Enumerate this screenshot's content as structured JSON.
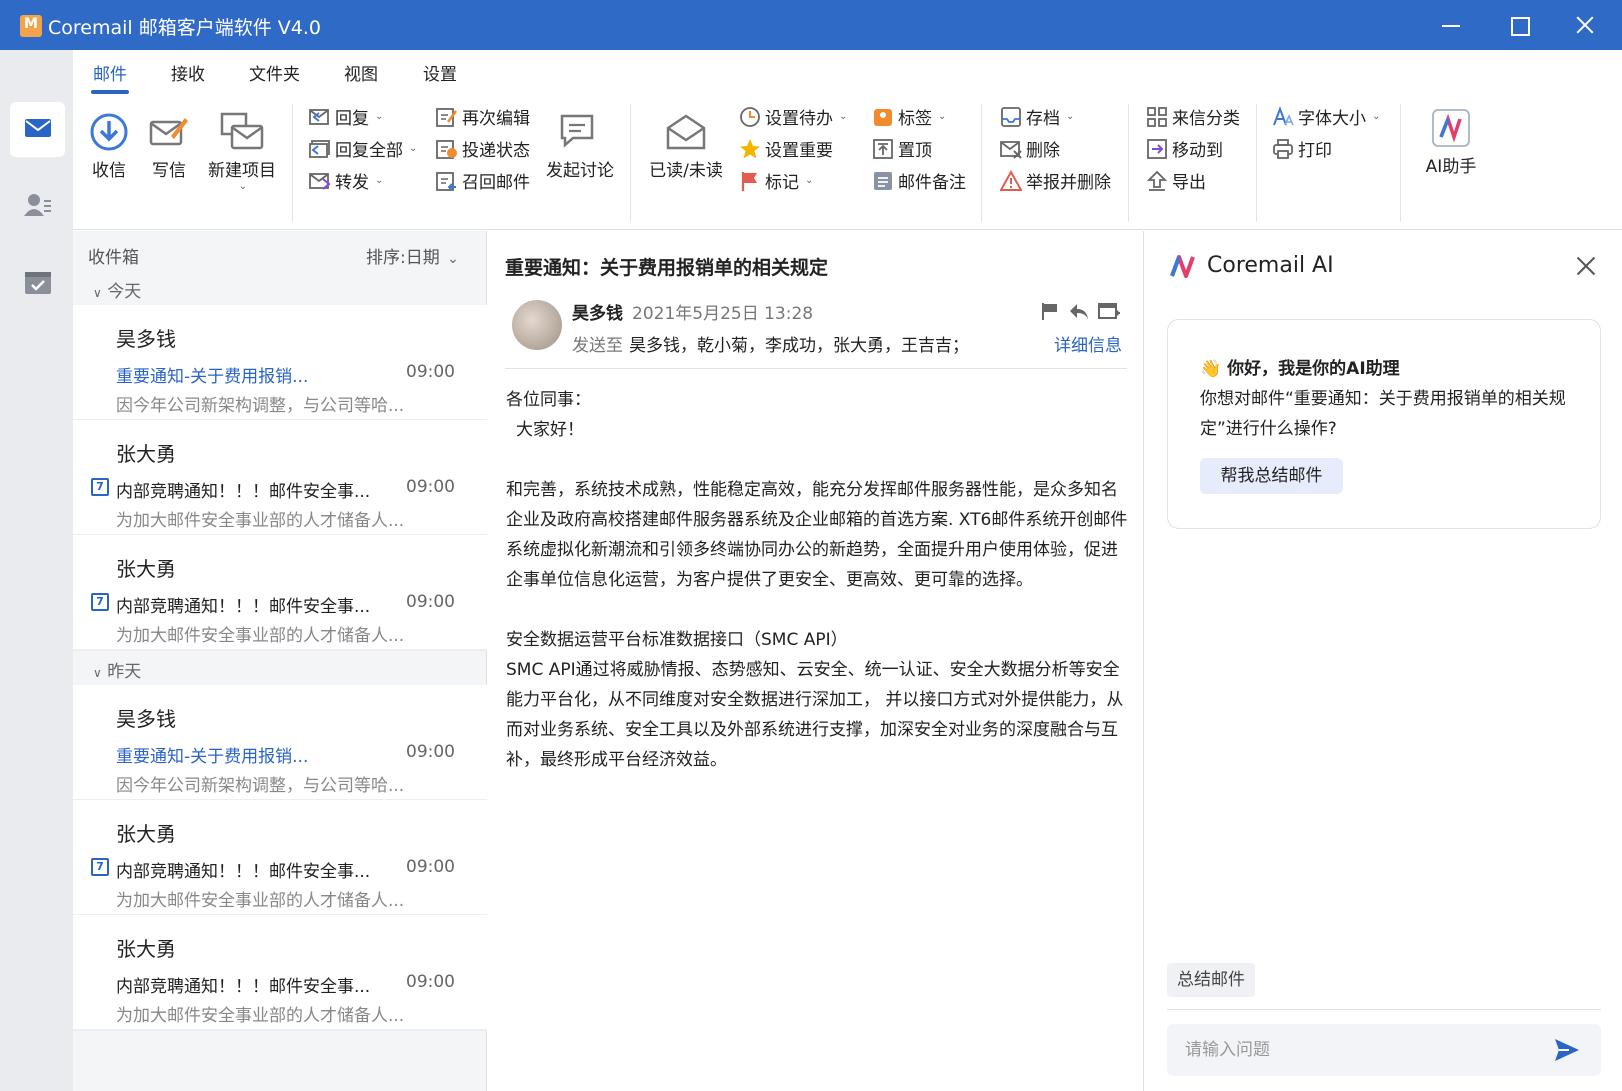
{
  "window": {
    "title": "Coremail 邮箱客户端软件 V4.0"
  },
  "menu": {
    "tabs": [
      "邮件",
      "接收",
      "文件夹",
      "视图",
      "设置"
    ]
  },
  "ribbon": {
    "receive": "收信",
    "compose": "写信",
    "new_item": "新建项目",
    "reply": "回复",
    "reply_all": "回复全部",
    "forward": "转发",
    "re_edit": "再次编辑",
    "delivery_status": "投递状态",
    "recall": "召回邮件",
    "discuss": "发起讨论",
    "read_unread": "已读/未读",
    "set_todo": "设置待办",
    "set_important": "设置重要",
    "flag": "标记",
    "tag": "标签",
    "pin": "置顶",
    "note": "邮件备注",
    "archive": "存档",
    "delete": "删除",
    "report_delete": "举报并删除",
    "classify": "来信分类",
    "move_to": "移动到",
    "export": "导出",
    "font_size": "字体大小",
    "print": "打印",
    "ai_assistant": "AI助手"
  },
  "mail_list": {
    "folder": "收件箱",
    "sort": "排序:日期",
    "groups": {
      "today": "今天",
      "yesterday": "昨天"
    },
    "items": [
      {
        "sender": "昊多钱",
        "subject": "重要通知-关于费用报销...",
        "time": "09:00",
        "preview": "因今年公司新架构调整，与公司等哈..."
      },
      {
        "sender": "张大勇",
        "subject": "内部竞聘通知！！！邮件安全事...",
        "time": "09:00",
        "preview": "为加大邮件安全事业部的人才储备人..."
      },
      {
        "sender": "张大勇",
        "subject": "内部竞聘通知！！！邮件安全事...",
        "time": "09:00",
        "preview": "为加大邮件安全事业部的人才储备人..."
      },
      {
        "sender": "昊多钱",
        "subject": "重要通知-关于费用报销...",
        "time": "09:00",
        "preview": "因今年公司新架构调整，与公司等哈..."
      },
      {
        "sender": "张大勇",
        "subject": "内部竞聘通知！！！邮件安全事...",
        "time": "09:00",
        "preview": "为加大邮件安全事业部的人才储备人..."
      },
      {
        "sender": "张大勇",
        "subject": "内部竞聘通知！！！邮件安全事...",
        "time": "09:00",
        "preview": "为加大邮件安全事业部的人才储备人..."
      }
    ],
    "calendar_badge": "7"
  },
  "reading": {
    "subject": "重要通知：关于费用报销单的相关规定",
    "from": "昊多钱",
    "date": "2021年5月25日 13:28",
    "to_label": "发送至",
    "to": "昊多钱，乾小菊，李成功，张大勇，王吉吉；",
    "detail_link": "详细信息",
    "body": {
      "greeting": "各位同事：",
      "hello": "大家好！",
      "p1": "和完善，系统技术成熟，性能稳定高效，能充分发挥邮件服务器性能，是众多知名企业及政府高校搭建邮件服务器系统及企业邮箱的首选方案. XT6邮件系统开创邮件系统虚拟化新潮流和引领多终端协同办公的新趋势，全面提升用户使用体验，促进企事单位信息化运营，为客户提供了更安全、更高效、更可靠的选择。",
      "p2_title": "安全数据运营平台标准数据接口（SMC API）",
      "p2": "SMC API通过将威胁情报、态势感知、云安全、统一认证、安全大数据分析等安全能力平台化，从不同维度对安全数据进行深加工， 并以接口方式对外提供能力，从而对业务系统、安全工具以及外部系统进行支撑，加深安全对业务的深度融合与互补，最终形成平台经济效益。"
    }
  },
  "ai": {
    "title": "Coremail AI",
    "greeting": "你好，我是你的AI助理",
    "question": "你想对邮件“重要通知：关于费用报销单的相关规定”进行什么操作?",
    "summarize_button": "帮我总结邮件",
    "chip": "总结邮件",
    "input_placeholder": "请输入问题"
  },
  "colors": {
    "accent": "#2a64c5",
    "titlebar": "#2f6ac7"
  }
}
